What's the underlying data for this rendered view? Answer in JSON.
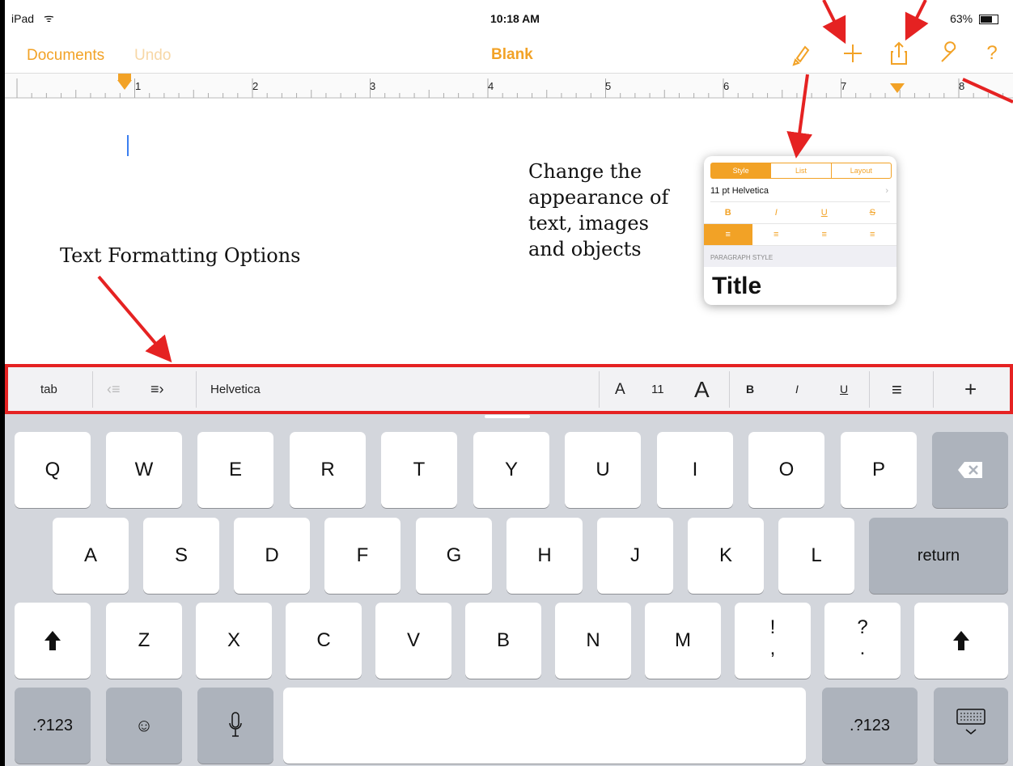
{
  "status": {
    "carrier": "iPad",
    "time": "10:18 AM",
    "battery": "63%"
  },
  "nav": {
    "documents": "Documents",
    "undo": "Undo",
    "title": "Blank"
  },
  "ruler": {
    "marks": [
      "1",
      "2",
      "3",
      "4",
      "5",
      "6",
      "7",
      "8"
    ]
  },
  "annotations": {
    "format": "Text Formatting Options",
    "appearance_lines": [
      "Change the",
      "appearance of",
      "text, images",
      "and objects"
    ]
  },
  "popover": {
    "tabs": [
      "Style",
      "List",
      "Layout"
    ],
    "font": "11 pt Helvetica",
    "styles": [
      "B",
      "I",
      "U",
      "S"
    ],
    "section": "PARAGRAPH STYLE",
    "title_preview": "Title"
  },
  "toolbar": {
    "tab": "tab",
    "font": "Helvetica",
    "size_small": "A",
    "size": "11",
    "size_large": "A",
    "bold": "B",
    "italic": "I",
    "underline": "U",
    "add": "+"
  },
  "keyboard": {
    "row1": [
      "Q",
      "W",
      "E",
      "R",
      "T",
      "Y",
      "U",
      "I",
      "O",
      "P"
    ],
    "row2": [
      "A",
      "S",
      "D",
      "F",
      "G",
      "H",
      "J",
      "K",
      "L"
    ],
    "return": "return",
    "row3": [
      "Z",
      "X",
      "C",
      "V",
      "B",
      "N",
      "M"
    ],
    "punct1_top": "!",
    "punct1_bottom": ",",
    "punct2_top": "?",
    "punct2_bottom": ".",
    "numbers": ".?123",
    "numbers_right": ".?123"
  },
  "colors": {
    "accent": "#f2a226",
    "annotation_red": "#e52222"
  }
}
